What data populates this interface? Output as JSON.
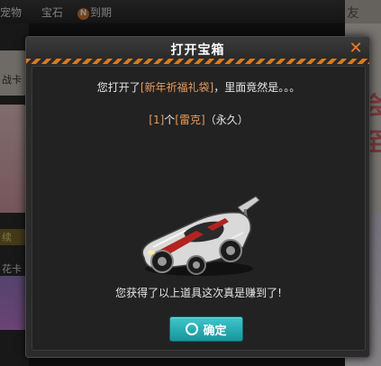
{
  "background": {
    "tabs": [
      "宠物",
      "宝石",
      "到期"
    ],
    "badge_letter": "N",
    "right_header_char": "友",
    "left_labels": [
      "战卡",
      "续",
      "花卡"
    ]
  },
  "dialog": {
    "title": "打开宝箱",
    "close_symbol": "✕",
    "open_prefix": "您打开了",
    "box_name": "[新年祈福礼袋]",
    "open_suffix": "，里面竟然是。。。",
    "item_count": "[1]",
    "item_count_unit": "个",
    "item_name": "[雷克]",
    "item_duration": "（永久）",
    "footer_message": "您获得了以上道具这次真是赚到了!",
    "confirm_label": "确定"
  },
  "colors": {
    "accent_orange": "#f07c22",
    "highlight_text": "#e89a5a",
    "confirm_teal": "#22a9ae"
  },
  "icons": {
    "close": "close-icon",
    "confirm": "ok-circle-icon",
    "item": "race-car-icon"
  }
}
